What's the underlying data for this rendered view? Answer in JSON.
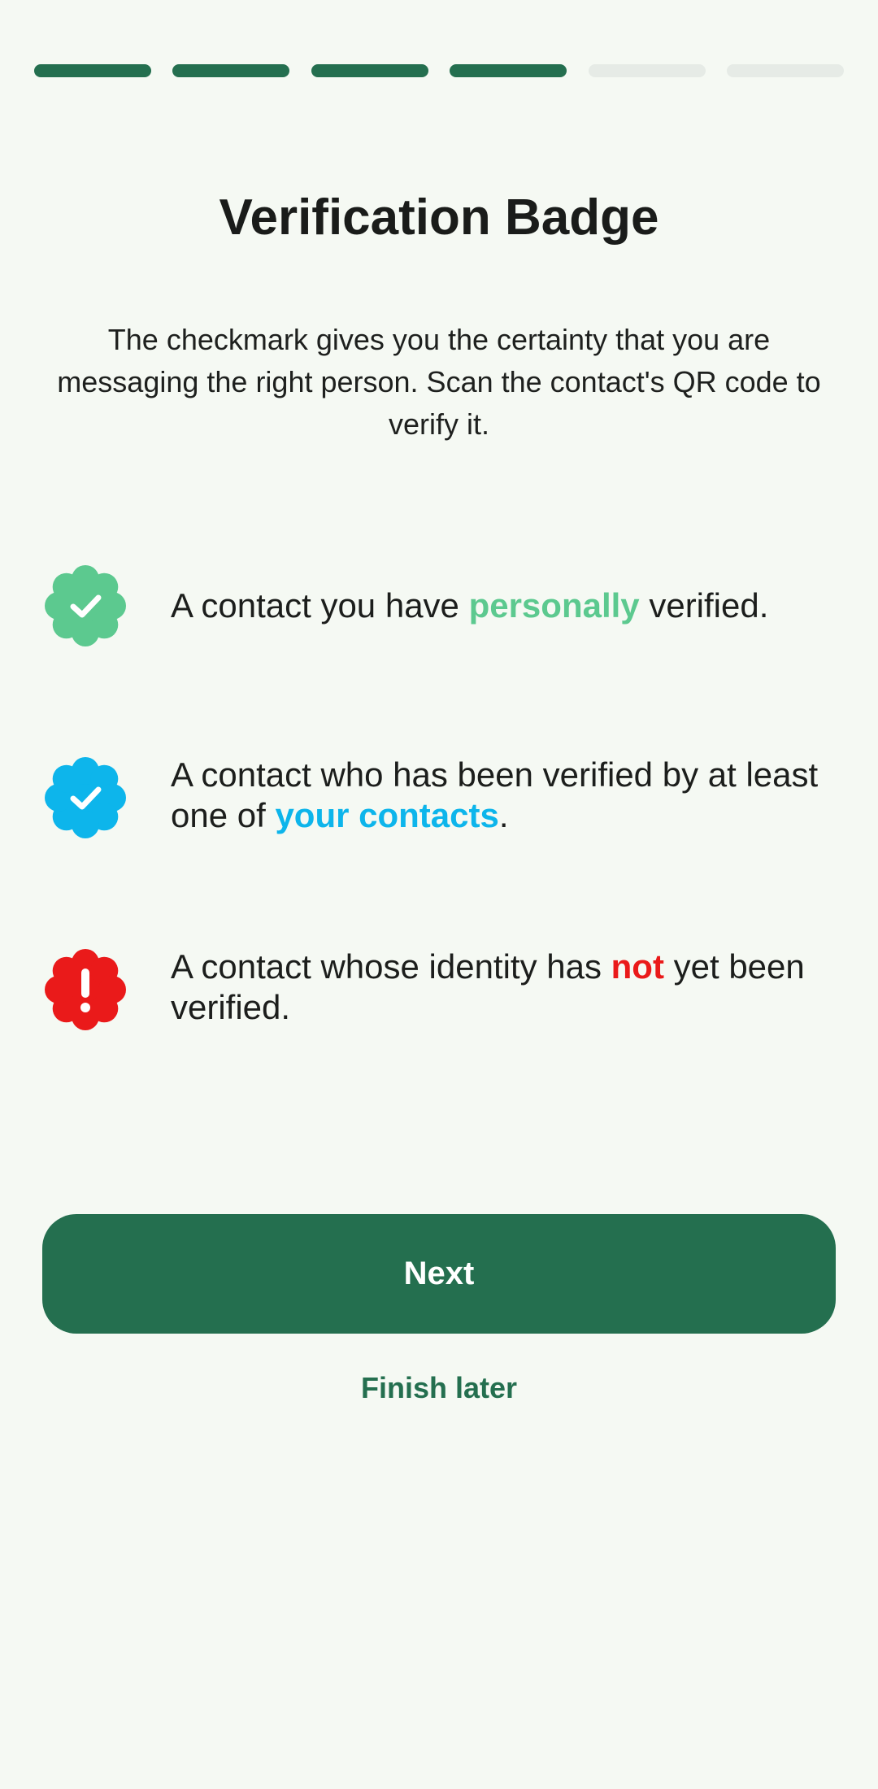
{
  "progress": {
    "total_steps": 6,
    "completed_steps": 4
  },
  "title": "Verification Badge",
  "description": "The checkmark gives you the certainty that you are messaging the right person. Scan the contact's QR code to verify it.",
  "items": [
    {
      "icon": "green-check-badge-icon",
      "color": "#5cc98f",
      "before": "A contact you have ",
      "highlight": "personally",
      "after": " verified."
    },
    {
      "icon": "blue-check-badge-icon",
      "color": "#0db5eb",
      "before": "A contact who has been verified by at least one of ",
      "highlight": "your contacts",
      "after": "."
    },
    {
      "icon": "red-exclamation-badge-icon",
      "color": "#ea1a1a",
      "before": "A contact whose identity has ",
      "highlight": "not",
      "after": " yet been verified."
    }
  ],
  "next_button": "Next",
  "finish_later": "Finish later",
  "colors": {
    "primary": "#246f4f",
    "background": "#f5f9f3"
  }
}
